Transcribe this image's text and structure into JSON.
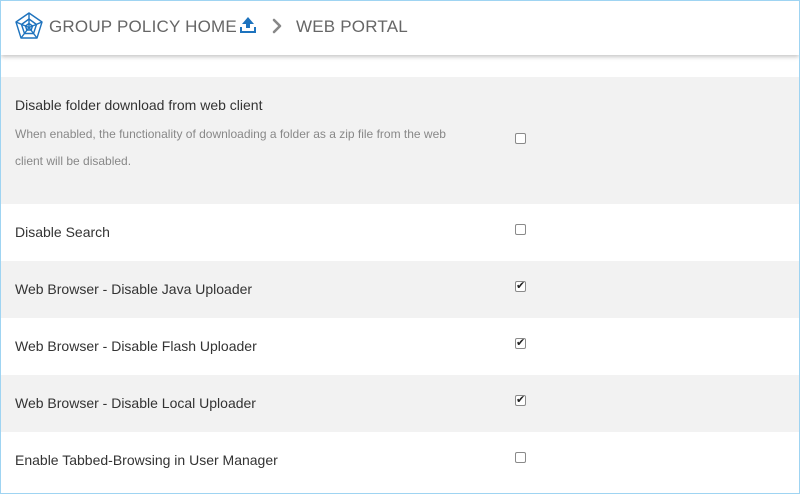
{
  "header": {
    "logo_icon": "spider-web-icon",
    "breadcrumb_home": "GROUP POLICY HOME",
    "upload_icon": "upload-icon",
    "separator_icon": "chevron-right-icon",
    "breadcrumb_current": "WEB PORTAL"
  },
  "colors": {
    "accent_blue": "#1e73be",
    "row_shade": "#f2f2f2",
    "border": "#9fd4f2"
  },
  "settings": [
    {
      "title": "Disable folder download from web client",
      "description": "When enabled, the functionality of downloading a folder as a zip file from the web client will be disabled.",
      "checked": false
    },
    {
      "title": "Disable Search",
      "checked": false
    },
    {
      "title": "Web Browser - Disable Java Uploader",
      "checked": true
    },
    {
      "title": "Web Browser - Disable Flash Uploader",
      "checked": true
    },
    {
      "title": "Web Browser - Disable Local Uploader",
      "checked": true
    },
    {
      "title": "Enable Tabbed-Browsing in User Manager",
      "checked": false
    }
  ]
}
